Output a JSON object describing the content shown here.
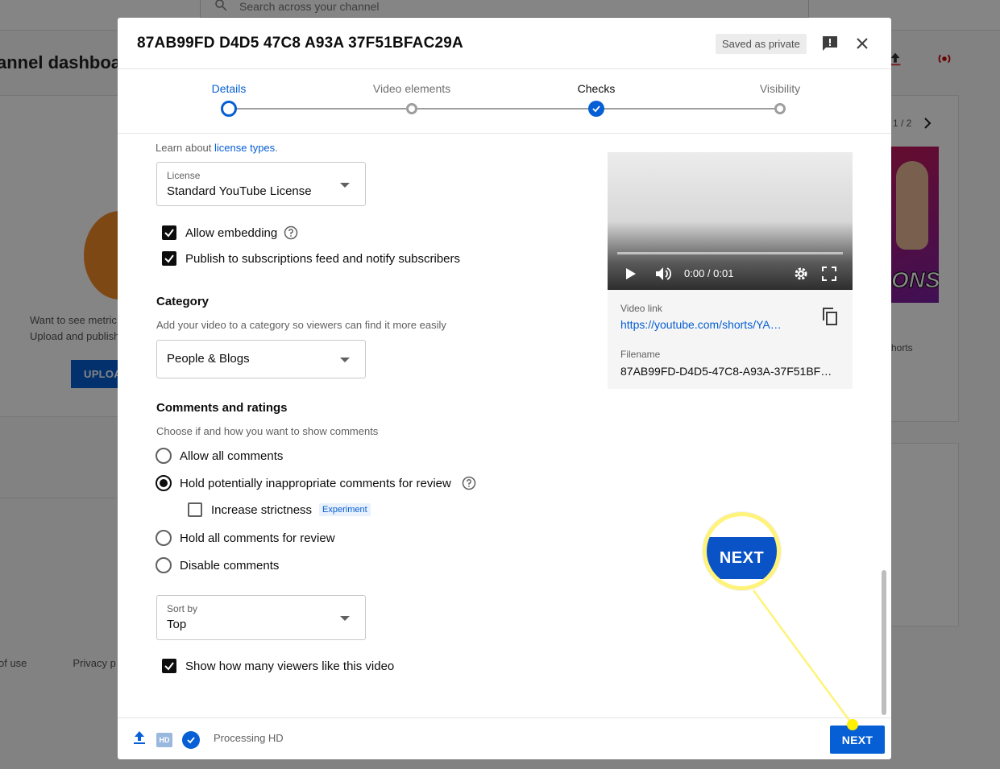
{
  "background": {
    "search_placeholder": "Search across your channel",
    "page_title": "annel dashboa",
    "empty_text_line1": "Want to see metric",
    "empty_text_line2": "Upload and publish",
    "upload_button": "UPLOA",
    "footer_links": [
      "of use",
      "Privacy p"
    ],
    "pager": "1 / 2",
    "thumb_text": "ONS",
    "shorts_label": "horts"
  },
  "dialog": {
    "title": "87AB99FD D4D5 47C8 A93A 37F51BFAC29A",
    "saved_badge": "Saved as private",
    "stepper": {
      "steps": [
        {
          "label": "Details",
          "state": "current"
        },
        {
          "label": "Video elements",
          "state": "pending"
        },
        {
          "label": "Checks",
          "state": "done"
        },
        {
          "label": "Visibility",
          "state": "pending"
        }
      ]
    },
    "license": {
      "learn_prefix": "Learn about ",
      "learn_link": "license types",
      "learn_suffix": ".",
      "field_label": "License",
      "value": "Standard YouTube License"
    },
    "options": {
      "allow_embedding": "Allow embedding",
      "publish_feed": "Publish to subscriptions feed and notify subscribers"
    },
    "category": {
      "title": "Category",
      "description": "Add your video to a category so viewers can find it more easily",
      "value": "People & Blogs"
    },
    "comments": {
      "title": "Comments and ratings",
      "description": "Choose if and how you want to show comments",
      "allow_all": "Allow all comments",
      "hold_inappropriate": "Hold potentially inappropriate comments for review",
      "increase_strictness": "Increase strictness",
      "experiment_tag": "Experiment",
      "hold_all": "Hold all comments for review",
      "disable": "Disable comments",
      "selected": "hold_inappropriate"
    },
    "sort": {
      "field_label": "Sort by",
      "value": "Top"
    },
    "show_likes": "Show how many viewers like this video",
    "video": {
      "time": "0:00 / 0:01",
      "link_label": "Video link",
      "link": "https://youtube.com/shorts/YA…",
      "filename_label": "Filename",
      "filename": "87AB99FD-D4D5-47C8-A93A-37F51BF…"
    },
    "footer": {
      "hd_badge": "HD",
      "processing": "Processing HD",
      "next": "NEXT"
    }
  },
  "callout": {
    "text": "NEXT",
    "color": "#fff37a"
  },
  "colors": {
    "accent": "#065fd4",
    "callout_yellow": "#fff000"
  }
}
